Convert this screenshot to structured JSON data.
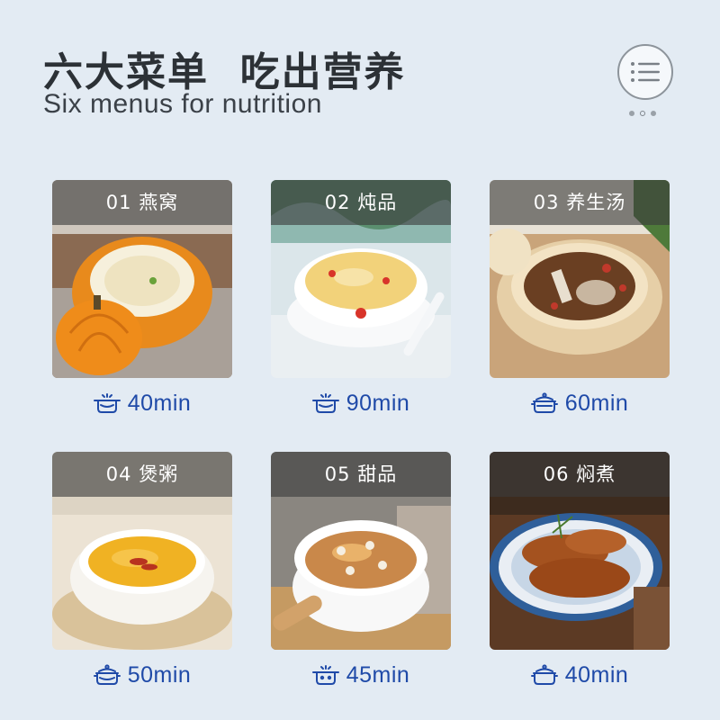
{
  "header": {
    "title": "六大菜单  吃出营养",
    "subtitle": "Six menus for nutrition",
    "menu_icon": "list-icon",
    "page_indicator": {
      "total": 3,
      "active": 2
    }
  },
  "colors": {
    "background": "#e3ebf3",
    "accent": "#1f4aa8",
    "label_overlay": "#3c3c3c"
  },
  "menus": [
    {
      "label": "01 燕窝",
      "time": "40min",
      "icon": "pot-icon"
    },
    {
      "label": "02 炖品",
      "time": "90min",
      "icon": "pot-icon"
    },
    {
      "label": "03 养生汤",
      "time": "60min",
      "icon": "pot-icon"
    },
    {
      "label": "04 煲粥",
      "time": "50min",
      "icon": "pot-icon"
    },
    {
      "label": "05 甜品",
      "time": "45min",
      "icon": "pot-icon"
    },
    {
      "label": "06 焖煮",
      "time": "40min",
      "icon": "pot-icon"
    }
  ]
}
